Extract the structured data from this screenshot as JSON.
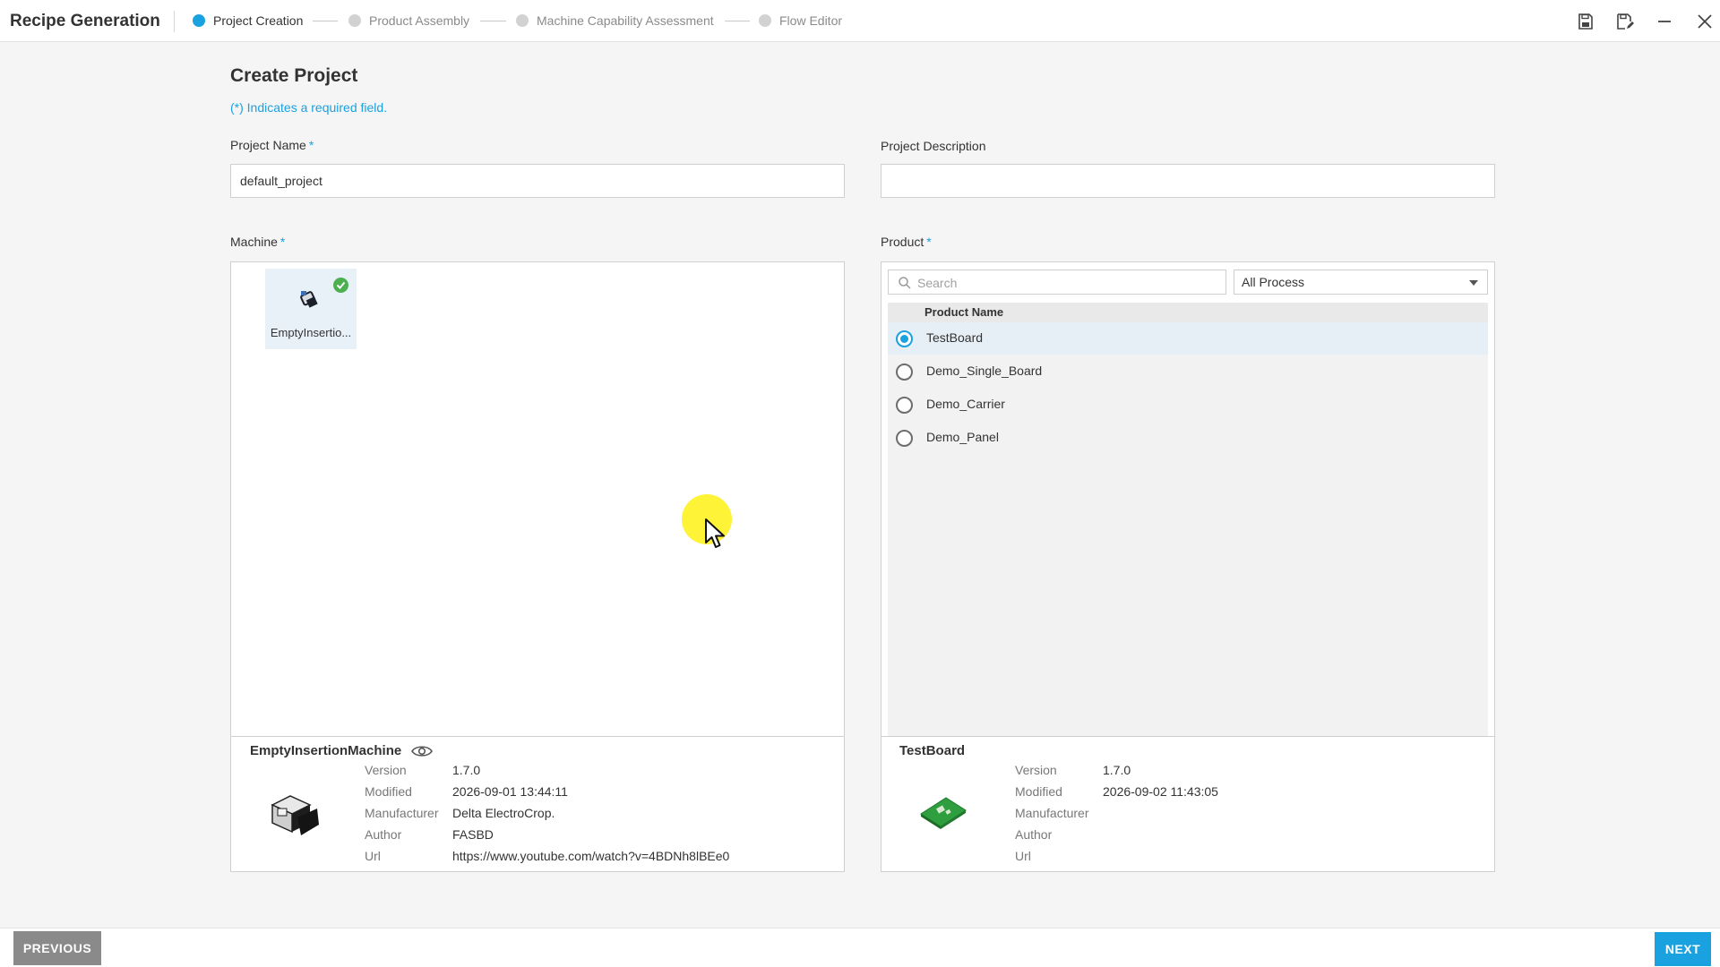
{
  "app": {
    "title": "Recipe Generation"
  },
  "steps": [
    {
      "label": "Project Creation",
      "active": true
    },
    {
      "label": "Product Assembly",
      "active": false
    },
    {
      "label": "Machine Capability Assessment",
      "active": false
    },
    {
      "label": "Flow Editor",
      "active": false
    }
  ],
  "window_controls": {
    "save_icon": "save-icon",
    "save_as_icon": "save-as-icon",
    "minimize_icon": "minimize-icon",
    "close_icon": "close-icon"
  },
  "form": {
    "heading": "Create Project",
    "required_note": "(*) Indicates a required field.",
    "required_mark": "*",
    "project_name_label": "Project Name",
    "project_name_value": "default_project",
    "project_description_label": "Project Description",
    "project_description_value": "",
    "machine_label": "Machine",
    "product_label": "Product"
  },
  "machine": {
    "tile_label": "EmptyInsertio...",
    "tile_selected": true,
    "detail": {
      "name": "EmptyInsertionMachine",
      "fields": [
        {
          "key": "Version",
          "value": "1.7.0"
        },
        {
          "key": "Modified",
          "value": "2026-09-01 13:44:11"
        },
        {
          "key": "Manufacturer",
          "value": "Delta ElectroCrop."
        },
        {
          "key": "Author",
          "value": "FASBD"
        },
        {
          "key": "Url",
          "value": "https://www.youtube.com/watch?v=4BDNh8lBEe0"
        }
      ]
    }
  },
  "product": {
    "search_placeholder": "Search",
    "filter_value": "All Process",
    "column_header": "Product Name",
    "items": [
      {
        "name": "TestBoard",
        "selected": true
      },
      {
        "name": "Demo_Single_Board",
        "selected": false
      },
      {
        "name": "Demo_Carrier",
        "selected": false
      },
      {
        "name": "Demo_Panel",
        "selected": false
      }
    ],
    "detail": {
      "name": "TestBoard",
      "fields": [
        {
          "key": "Version",
          "value": "1.7.0"
        },
        {
          "key": "Modified",
          "value": "2026-09-02 11:43:05"
        },
        {
          "key": "Manufacturer",
          "value": ""
        },
        {
          "key": "Author",
          "value": ""
        },
        {
          "key": "Url",
          "value": ""
        }
      ]
    }
  },
  "footer": {
    "previous_label": "PREVIOUS",
    "next_label": "NEXT"
  },
  "colors": {
    "accent": "#1aa1e0",
    "success": "#4caf50",
    "button_disabled": "#8a8a8a"
  }
}
